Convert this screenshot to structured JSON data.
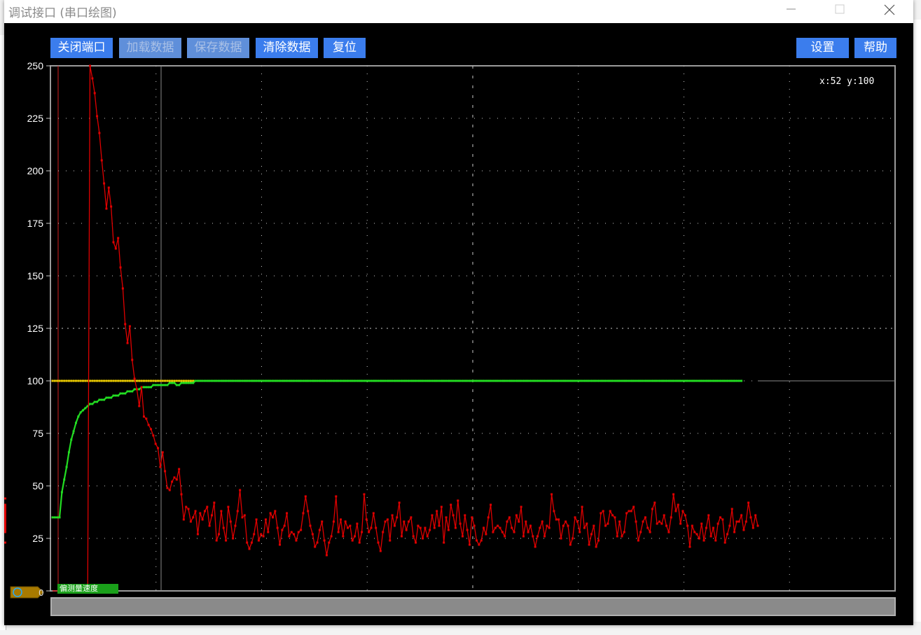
{
  "window": {
    "title": "调试接口 (串口绘图)",
    "min_icon": "minimize-icon",
    "max_icon": "maximize-icon",
    "close_icon": "close-icon"
  },
  "toolbar": {
    "buttons": [
      {
        "label": "关闭端口",
        "enabled": true
      },
      {
        "label": "加载数据",
        "enabled": false
      },
      {
        "label": "保存数据",
        "enabled": false
      },
      {
        "label": "清除数据",
        "enabled": true
      },
      {
        "label": "复位",
        "enabled": true
      }
    ],
    "settings_label": "设置",
    "help_label": "帮助"
  },
  "readout": "x:52 y:100",
  "channel": {
    "zero_label": "0",
    "tag_label": "偏测量速度"
  },
  "colors": {
    "background": "#000000",
    "button": "#3b7ded",
    "grid": "#c8c8c8",
    "red_series": "#e00000",
    "green_series": "#22dd22",
    "yellow_series": "#e8c800"
  },
  "chart_data": {
    "type": "line",
    "ylim": [
      0,
      250
    ],
    "yticks": [
      "250",
      "225",
      "200",
      "175",
      "150",
      "125",
      "100",
      "75",
      "50",
      "25",
      "0"
    ],
    "x": [
      0,
      1,
      2,
      3,
      4,
      5,
      6,
      7,
      8,
      9,
      10,
      11,
      12,
      13,
      14,
      15,
      16,
      17,
      18,
      19,
      20,
      21,
      22,
      23,
      24,
      25,
      26,
      27,
      28,
      29,
      30,
      31,
      32,
      33,
      34,
      35,
      36,
      37,
      38,
      39,
      40,
      41,
      42,
      43,
      44,
      45,
      46,
      47,
      48,
      49,
      50,
      51,
      52,
      53,
      54,
      55,
      56,
      57,
      58,
      59,
      60,
      61,
      62,
      63,
      64,
      65,
      66,
      67,
      68,
      69,
      70,
      71,
      72,
      73,
      74,
      75,
      76,
      77,
      78,
      79,
      80,
      81,
      82,
      83,
      84,
      85,
      86,
      87,
      88,
      89,
      90,
      91,
      92,
      93,
      94,
      95,
      96,
      97,
      98,
      99,
      100,
      101,
      102,
      103,
      104,
      105,
      106,
      107,
      108,
      109,
      110,
      111,
      112,
      113,
      114,
      115,
      116,
      117,
      118,
      119,
      120,
      121,
      122,
      123,
      124,
      125,
      126,
      127,
      128,
      129,
      130,
      131,
      132,
      133,
      134,
      135,
      136,
      137,
      138,
      139,
      140,
      141,
      142,
      143,
      144,
      145,
      146,
      147,
      148,
      149,
      150,
      151,
      152,
      153,
      154,
      155,
      156,
      157,
      158,
      159,
      160,
      161,
      162,
      163,
      164,
      165,
      166,
      167,
      168,
      169,
      170,
      171,
      172,
      173,
      174,
      175,
      176,
      177,
      178,
      179,
      180,
      181,
      182,
      183,
      184,
      185,
      186,
      187,
      188,
      189,
      190,
      191,
      192,
      193,
      194,
      195,
      196,
      197,
      198,
      199,
      200,
      201,
      202,
      203,
      204,
      205,
      206,
      207,
      208,
      209,
      210,
      211,
      212,
      213,
      214,
      215,
      216,
      217,
      218,
      219,
      220,
      221,
      222,
      223,
      224,
      225,
      226,
      227,
      228,
      229,
      230,
      231,
      232,
      233,
      234,
      235,
      236,
      237,
      238,
      239,
      240,
      241,
      242,
      243,
      244,
      245,
      246,
      247,
      248,
      249,
      250,
      251,
      252,
      253,
      254,
      255,
      256,
      257,
      258,
      259,
      260,
      261,
      262,
      263,
      264,
      265,
      266,
      267,
      268,
      269,
      270,
      271,
      272,
      273,
      274,
      275,
      276,
      277,
      278,
      279,
      280,
      281,
      282,
      283,
      284,
      285,
      286,
      287,
      288,
      289,
      290,
      291,
      292,
      293,
      294,
      295,
      296,
      297,
      298,
      299,
      300,
      301
    ],
    "series": [
      {
        "color": "#e00000",
        "values": [
          0,
          0,
          0,
          0,
          0,
          0,
          0,
          0,
          0,
          0,
          0,
          0,
          0,
          0,
          0,
          0,
          250,
          244,
          237,
          226,
          218,
          205,
          194,
          182,
          192,
          183,
          166,
          163,
          168,
          154,
          144,
          127,
          118,
          126,
          110,
          101,
          96,
          88,
          97,
          83,
          82,
          79,
          77,
          74,
          70,
          68,
          59,
          66,
          57,
          49,
          48,
          52,
          54,
          53,
          58,
          46,
          34,
          40,
          39,
          33,
          35,
          38,
          27,
          37,
          34,
          38,
          40,
          31,
          36,
          42,
          24,
          27,
          38,
          30,
          24,
          40,
          33,
          25,
          31,
          38,
          48,
          35,
          36,
          23,
          20,
          23,
          27,
          34,
          24,
          27,
          26,
          34,
          28,
          37,
          35,
          38,
          30,
          22,
          29,
          31,
          37,
          26,
          28,
          27,
          24,
          28,
          29,
          37,
          45,
          38,
          31,
          27,
          21,
          23,
          29,
          33,
          24,
          17,
          23,
          26,
          33,
          45,
          28,
          34,
          26,
          33,
          30,
          31,
          24,
          26,
          32,
          23,
          28,
          46,
          34,
          28,
          30,
          37,
          30,
          23,
          19,
          28,
          33,
          34,
          24,
          36,
          31,
          35,
          42,
          26,
          33,
          29,
          33,
          35,
          26,
          23,
          31,
          30,
          25,
          30,
          26,
          29,
          36,
          30,
          38,
          31,
          40,
          23,
          35,
          29,
          41,
          36,
          30,
          43,
          32,
          26,
          36,
          29,
          22,
          35,
          31,
          24,
          22,
          24,
          30,
          27,
          35,
          41,
          28,
          30,
          31,
          30,
          28,
          26,
          33,
          35,
          30,
          28,
          36,
          33,
          40,
          26,
          33,
          28,
          31,
          26,
          21,
          26,
          30,
          33,
          26,
          31,
          30,
          46,
          38,
          34,
          34,
          25,
          31,
          33,
          31,
          22,
          25,
          35,
          33,
          28,
          40,
          30,
          32,
          22,
          27,
          31,
          21,
          24,
          37,
          38,
          31,
          32,
          38,
          36,
          35,
          26,
          33,
          26,
          28,
          37,
          38,
          38,
          40,
          33,
          24,
          28,
          33,
          35,
          30,
          28,
          39,
          42,
          32,
          33,
          32,
          36,
          31,
          28,
          35,
          46,
          38,
          41,
          32,
          38,
          36,
          31,
          21,
          31,
          28,
          27,
          25,
          32,
          24,
          30,
          36,
          26,
          30,
          24,
          32,
          35,
          34,
          23,
          27,
          31,
          39,
          28,
          33,
          33,
          36,
          29,
          33,
          42,
          35,
          30,
          36,
          31,
          40,
          41,
          23,
          34,
          31,
          31,
          36,
          44,
          35,
          35,
          33,
          28,
          31,
          33,
          23,
          32,
          33,
          32,
          38,
          39,
          32,
          38,
          31,
          40,
          33,
          39,
          31,
          36,
          36,
          37,
          33,
          29,
          33,
          33,
          29,
          31,
          33,
          28,
          29,
          31,
          37,
          30,
          30,
          35,
          36,
          35,
          30,
          31,
          37,
          32,
          32,
          34,
          32,
          34,
          31,
          31,
          33,
          32,
          30,
          29,
          28
        ]
      },
      {
        "color": "#22dd22",
        "values": [
          35,
          35,
          35,
          35,
          47,
          53,
          59,
          66,
          72,
          76,
          80,
          83,
          85,
          86,
          87,
          88,
          89,
          89,
          90,
          90,
          91,
          91,
          91,
          92,
          92,
          92,
          93,
          93,
          93,
          94,
          94,
          94,
          95,
          95,
          95,
          96,
          96,
          96,
          97,
          97,
          97,
          97,
          97,
          98,
          98,
          98,
          98,
          98,
          98,
          98,
          99,
          99,
          99,
          98,
          98,
          99,
          99,
          99,
          99,
          99,
          99,
          100,
          100,
          100,
          100,
          100,
          100,
          100,
          100,
          100,
          100,
          100,
          100,
          100,
          100,
          100,
          100,
          100,
          100,
          100,
          100,
          100,
          100,
          100,
          100,
          100,
          100,
          100,
          100,
          100,
          100,
          100,
          100,
          100,
          100,
          100,
          100,
          100,
          100,
          100,
          100,
          100,
          100,
          100,
          100,
          100,
          100,
          100,
          100,
          100,
          100,
          100,
          100,
          100,
          100,
          100,
          100,
          100,
          100,
          100,
          100,
          100,
          100,
          100,
          100,
          100,
          100,
          100,
          100,
          100,
          100,
          100,
          100,
          100,
          100,
          100,
          100,
          100,
          100,
          100,
          100,
          100,
          100,
          100,
          100,
          100,
          100,
          100,
          100,
          100,
          100,
          100,
          100,
          100,
          100,
          100,
          100,
          100,
          100,
          100,
          100,
          100,
          100,
          100,
          100,
          100,
          100,
          100,
          100,
          100,
          100,
          100,
          100,
          100,
          100,
          100,
          100,
          100,
          100,
          100,
          100,
          100,
          100,
          100,
          100,
          100,
          100,
          100,
          100,
          100,
          100,
          100,
          100,
          100,
          100,
          100,
          100,
          100,
          100,
          100,
          100,
          100,
          100,
          100,
          100,
          100,
          100,
          100,
          100,
          100,
          100,
          100,
          100,
          100,
          100,
          100,
          100,
          100,
          100,
          100,
          100,
          100,
          100,
          100,
          100,
          100,
          100,
          100,
          100,
          100,
          100,
          100,
          100,
          100,
          100,
          100,
          100,
          100,
          100,
          100,
          100,
          100,
          100,
          100,
          100,
          100,
          100,
          100,
          100,
          100,
          100,
          100,
          100,
          100,
          100,
          100,
          100,
          100,
          100,
          100,
          100,
          100,
          100,
          100,
          100,
          100,
          100,
          100,
          100,
          100,
          100,
          100,
          100,
          100,
          100,
          100,
          100,
          100,
          100,
          100,
          100,
          100,
          100,
          100,
          100,
          100,
          100,
          100,
          100,
          100,
          100,
          100,
          100,
          100,
          100
        ]
      },
      {
        "color": "#e8c800",
        "values": [
          100,
          100,
          100,
          100,
          100,
          100,
          100,
          100,
          100,
          100,
          100,
          100,
          100,
          100,
          100,
          100,
          100,
          100,
          100,
          100,
          100,
          100,
          100,
          100,
          100,
          100,
          100,
          100,
          100,
          100,
          100,
          100,
          100,
          100,
          100,
          100,
          100,
          100,
          100,
          100,
          100,
          100,
          100,
          100,
          100,
          100,
          100,
          100,
          100,
          100,
          100,
          100,
          100,
          100,
          100,
          100,
          100,
          100,
          100,
          100,
          100,
          100,
          100,
          100,
          100,
          100,
          100,
          100,
          100,
          100,
          100,
          100,
          100,
          100,
          100,
          100,
          100,
          100,
          100,
          100,
          100,
          100,
          100,
          100,
          100,
          100,
          100,
          100,
          100,
          100,
          100,
          100,
          100,
          100,
          100,
          100,
          100,
          100,
          100,
          100,
          100,
          100,
          100,
          100,
          100,
          100,
          100,
          100,
          100,
          100,
          100,
          100,
          100,
          100,
          100,
          100,
          100,
          100,
          100,
          100,
          100,
          100,
          100,
          100,
          100,
          100,
          100,
          100,
          100,
          100,
          100,
          100,
          100,
          100,
          100,
          100,
          100,
          100,
          100,
          100,
          100,
          100,
          100,
          100,
          100,
          100,
          100,
          100,
          100,
          100,
          100,
          100,
          100,
          100,
          100,
          100,
          100,
          100,
          100,
          100,
          100,
          100,
          100,
          100,
          100,
          100,
          100,
          100,
          100,
          100,
          100,
          100,
          100,
          100,
          100,
          100,
          100,
          100,
          100,
          100,
          100,
          100,
          100,
          100,
          100,
          100,
          100,
          100,
          100,
          100,
          100,
          100,
          100,
          100,
          100,
          100,
          100,
          100,
          100,
          100,
          100,
          100,
          100,
          100,
          100,
          100,
          100,
          100,
          100,
          100,
          100,
          100,
          100,
          100,
          100,
          100,
          100,
          100,
          100,
          100,
          100,
          100,
          100,
          100,
          100,
          100,
          100,
          100,
          100,
          100,
          100,
          100,
          100,
          100,
          100,
          100,
          100,
          100,
          100,
          100,
          100,
          100,
          100,
          100,
          100,
          100,
          100,
          100,
          100,
          100,
          100,
          100,
          100,
          100,
          100,
          100,
          100,
          100,
          100,
          100,
          100,
          100,
          100,
          100,
          100,
          100,
          100,
          100,
          100,
          100,
          100,
          100,
          100,
          100,
          100,
          100,
          100,
          100,
          100,
          100,
          100,
          100,
          100,
          100,
          100,
          100,
          100,
          100,
          100,
          100,
          100,
          100,
          100
        ]
      }
    ],
    "grid": true
  }
}
